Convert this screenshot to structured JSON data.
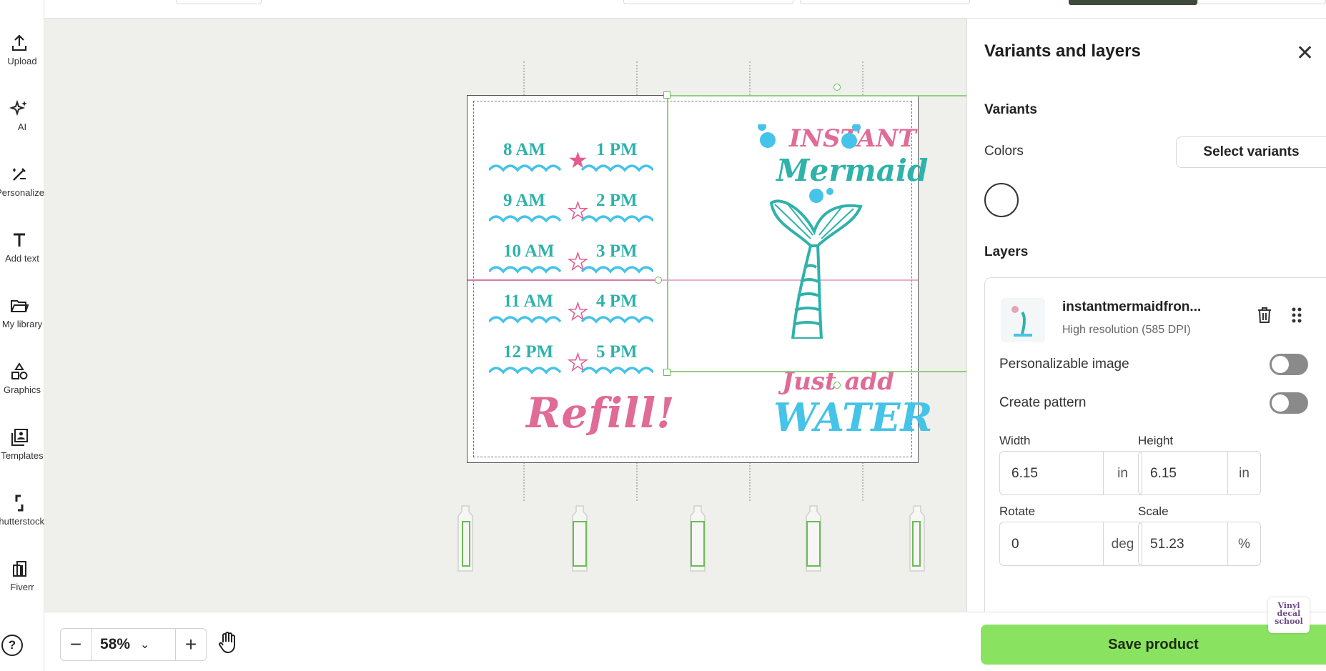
{
  "sidebar": {
    "items": [
      {
        "label": "Upload",
        "icon": "upload-icon"
      },
      {
        "label": "AI",
        "icon": "sparkle-icon"
      },
      {
        "label": "Personalize",
        "icon": "personalize-icon"
      },
      {
        "label": "Add text",
        "icon": "text-icon"
      },
      {
        "label": "My library",
        "icon": "folder-icon"
      },
      {
        "label": "Graphics",
        "icon": "shapes-icon"
      },
      {
        "label": "Templates",
        "icon": "templates-icon"
      },
      {
        "label": "Shutterstock",
        "icon": "shutterstock-icon"
      },
      {
        "label": "Fiverr",
        "icon": "fiverr-icon"
      }
    ],
    "help_icon": "help-icon",
    "help_label": "?"
  },
  "design": {
    "left_times": [
      "8 AM",
      "9 AM",
      "10 AM",
      "11 AM",
      "12 PM"
    ],
    "right_times": [
      "1 PM",
      "2 PM",
      "3 PM",
      "4 PM",
      "5 PM"
    ],
    "refill": "Refill!",
    "mermaid_line1": "INSTANT",
    "mermaid_line2": "Mermaid",
    "mermaid_line3": "Just add",
    "mermaid_line4": "WATER",
    "colors": {
      "teal": "#2fb2aa",
      "pink": "#e06b95",
      "blue": "#45c3e8",
      "selection": "#8fcf7c"
    }
  },
  "panel": {
    "title": "Variants and layers",
    "close_icon": "close-icon",
    "variants_heading": "Variants",
    "colors_label": "Colors",
    "select_variants_label": "Select variants",
    "layers_heading": "Layers",
    "layer": {
      "name": "instantmermaidfron...",
      "resolution": "High resolution (585 DPI)",
      "personalizable_label": "Personalizable image",
      "create_pattern_label": "Create pattern",
      "width_label": "Width",
      "width_value": "6.15",
      "width_unit": "in",
      "height_label": "Height",
      "height_value": "6.15",
      "height_unit": "in",
      "rotate_label": "Rotate",
      "rotate_value": "0",
      "rotate_unit": "deg",
      "scale_label": "Scale",
      "scale_value": "51.23",
      "scale_unit": "%"
    }
  },
  "bottom": {
    "zoom_minus": "−",
    "zoom_value": "58%",
    "zoom_plus": "+",
    "save_label": "Save product"
  },
  "watermark": {
    "line1": "Vinyl",
    "line2": "decal",
    "line3": "school"
  }
}
